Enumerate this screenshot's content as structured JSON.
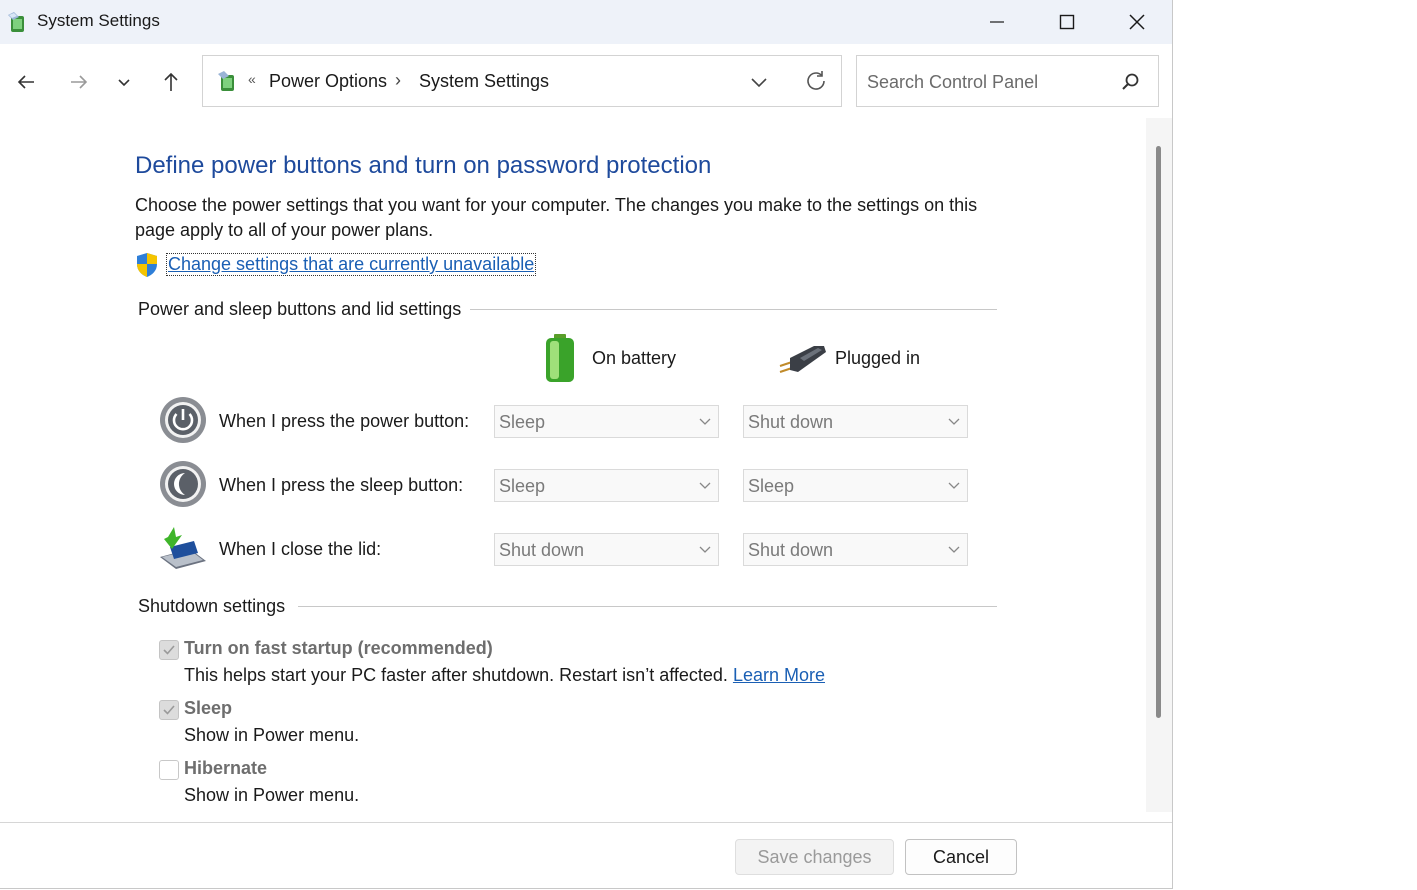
{
  "window": {
    "title": "System Settings"
  },
  "nav": {
    "breadcrumb": [
      "Power Options",
      "System Settings"
    ],
    "breadcrumb_prefix": "«",
    "breadcrumb_separator": "›"
  },
  "search": {
    "placeholder": "Search Control Panel"
  },
  "page": {
    "heading": "Define power buttons and turn on password protection",
    "description": "Choose the power settings that you want for your computer. The changes you make to the settings on this page apply to all of your power plans.",
    "change_link": "Change settings that are currently unavailable"
  },
  "power_group": {
    "title": "Power and sleep buttons and lid settings",
    "col_battery": "On battery",
    "col_plugged": "Plugged in",
    "rows": [
      {
        "label": "When I press the power button:",
        "battery": "Sleep",
        "plugged": "Shut down",
        "icon": "power-button-icon"
      },
      {
        "label": "When I press the sleep button:",
        "battery": "Sleep",
        "plugged": "Sleep",
        "icon": "sleep-button-icon"
      },
      {
        "label": "When I close the lid:",
        "battery": "Shut down",
        "plugged": "Shut down",
        "icon": "laptop-lid-icon"
      }
    ]
  },
  "shutdown_group": {
    "title": "Shutdown settings",
    "items": [
      {
        "label": "Turn on fast startup (recommended)",
        "desc": "This helps start your PC faster after shutdown. Restart isn’t affected.",
        "link": "Learn More",
        "checked": true
      },
      {
        "label": "Sleep",
        "desc": "Show in Power menu.",
        "checked": true
      },
      {
        "label": "Hibernate",
        "desc": "Show in Power menu.",
        "checked": false
      }
    ]
  },
  "footer": {
    "save_label": "Save changes",
    "cancel_label": "Cancel"
  },
  "colors": {
    "heading": "#1e4a9c",
    "link": "#1a5fb4",
    "titlebar": "#eef2f9"
  }
}
